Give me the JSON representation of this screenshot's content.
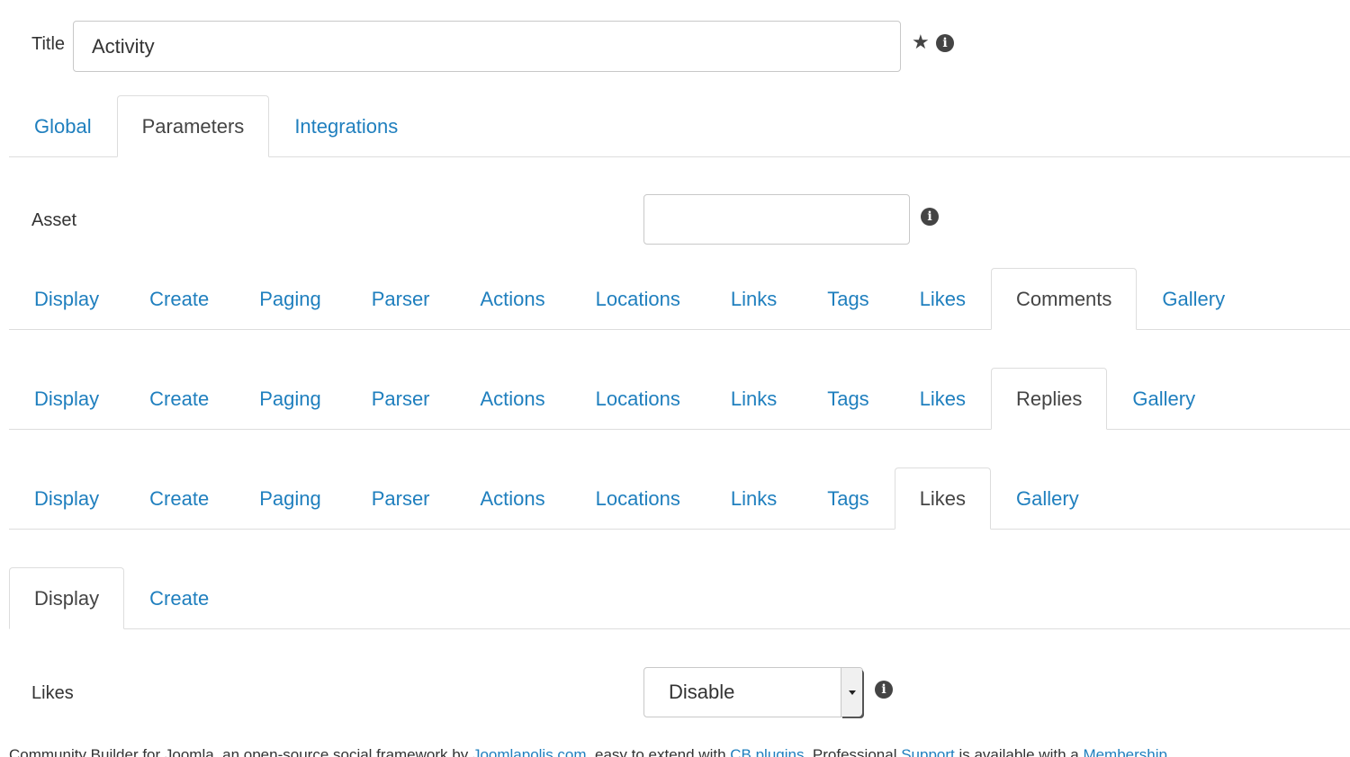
{
  "title_row": {
    "label": "Title",
    "value": "Activity"
  },
  "main_tabs": [
    "Global",
    "Parameters",
    "Integrations"
  ],
  "main_tabs_active": 1,
  "asset": {
    "label": "Asset",
    "value": ""
  },
  "tab_row_1": [
    "Display",
    "Create",
    "Paging",
    "Parser",
    "Actions",
    "Locations",
    "Links",
    "Tags",
    "Likes",
    "Comments",
    "Gallery"
  ],
  "tab_row_2": [
    "Display",
    "Create",
    "Paging",
    "Parser",
    "Actions",
    "Locations",
    "Links",
    "Tags",
    "Likes",
    "Replies",
    "Gallery"
  ],
  "tab_row_3": [
    "Display",
    "Create",
    "Paging",
    "Parser",
    "Actions",
    "Locations",
    "Links",
    "Tags",
    "Likes",
    "Gallery"
  ],
  "tab_row_4": [
    "Display",
    "Create"
  ],
  "likes_setting": {
    "label": "Likes",
    "selected": "Disable"
  },
  "footer": {
    "t1": "Community Builder for Joomla, an open-source social framework by ",
    "l1": "Joomlapolis.com",
    "t2": ", easy to extend with ",
    "l2": "CB plugins",
    "t3": ". Professional ",
    "l3": "Support",
    "t4": " is available with a ",
    "l4": "Membership"
  },
  "colors": {
    "link": "#1f7fbe",
    "text": "#333333",
    "border": "#dddddd"
  }
}
